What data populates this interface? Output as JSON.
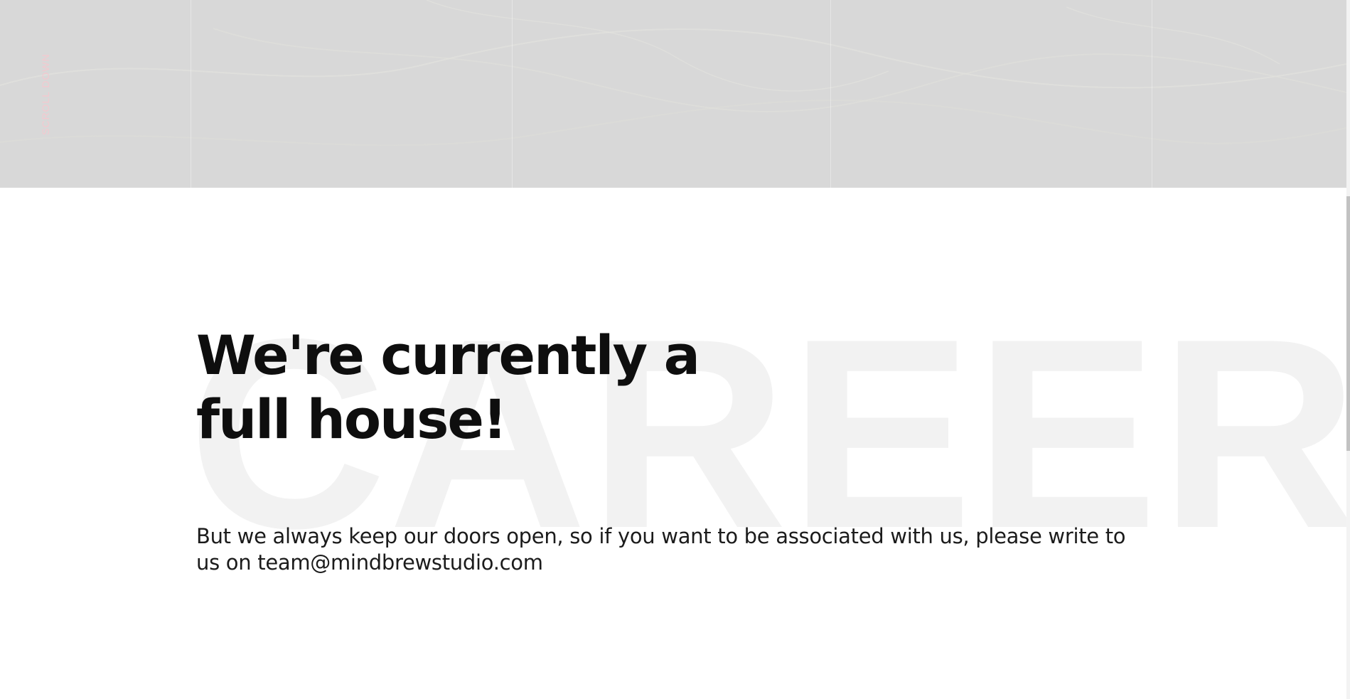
{
  "hero": {
    "scroll_label": "SCROLL DOWN",
    "background_color": "#d8d8d8"
  },
  "career": {
    "background_word": "CAREER",
    "headline": "We're currently a full house!",
    "body_prefix": "But we always keep our doors open, so if you want to be associated with us, please write to us on ",
    "email": "team@mindbrewstudio.com"
  },
  "colors": {
    "accent_pink": "#f3c9cf",
    "text_dark": "#0e0e0e",
    "watermark": "#f2f2f2"
  }
}
